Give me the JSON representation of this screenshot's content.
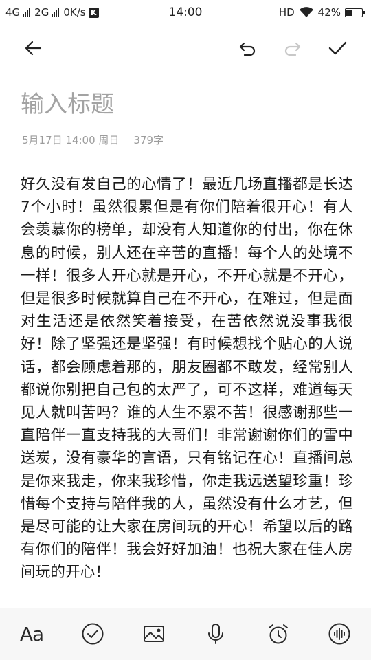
{
  "status_bar": {
    "network_left": "4G",
    "network_right": "2G",
    "speed": "0K/s",
    "k_badge": "K",
    "time": "14:00",
    "hd": "HD",
    "battery": "42%",
    "battery_level": 0.42
  },
  "toolbar": {
    "back_icon": "arrow-left-icon",
    "undo_icon": "undo-icon",
    "redo_icon": "redo-icon",
    "done_icon": "check-icon"
  },
  "note": {
    "title_placeholder": "输入标题",
    "date": "5月17日 14:00 周日",
    "word_count": "379字",
    "body": "好久没有发自己的心情了！最近几场直播都是长达7个小时！虽然很累但是有你们陪着很开心！有人会羡慕你的榜单，却没有人知道你的付出，你在休息的时候，别人还在辛苦的直播！每个人的处境不一样！很多人开心就是开心，不开心就是不开心，但是很多时候就算自己在不开心，在难过，但是面对生活还是依然笑着接受，在苦依然说没事我很好！除了坚强还是坚强！有时候想找个贴心的人说话，都会顾虑着那的，朋友圈都不敢发，经常别人都说你别把自己包的太严了，可不这样，难道每天见人就叫苦吗？谁的人生不累不苦！很感谢那些一直陪伴一直支持我的大哥们！非常谢谢你们的雪中送炭，没有豪华的言语，只有铭记在心！直播间总是你来我走，你来我珍惜，你走我远送望珍重！珍惜每个支持与陪伴我的人，虽然没有什么才艺，但是尽可能的让大家在房间玩的开心！希望以后的路有你们的陪伴！我会好好加油！也祝大家在佳人房间玩的开心！"
  },
  "bottom_bar": {
    "font_label": "Aa",
    "items": [
      "font-style-icon",
      "checklist-icon",
      "image-icon",
      "microphone-icon",
      "alarm-clock-icon",
      "audio-wave-icon"
    ]
  }
}
